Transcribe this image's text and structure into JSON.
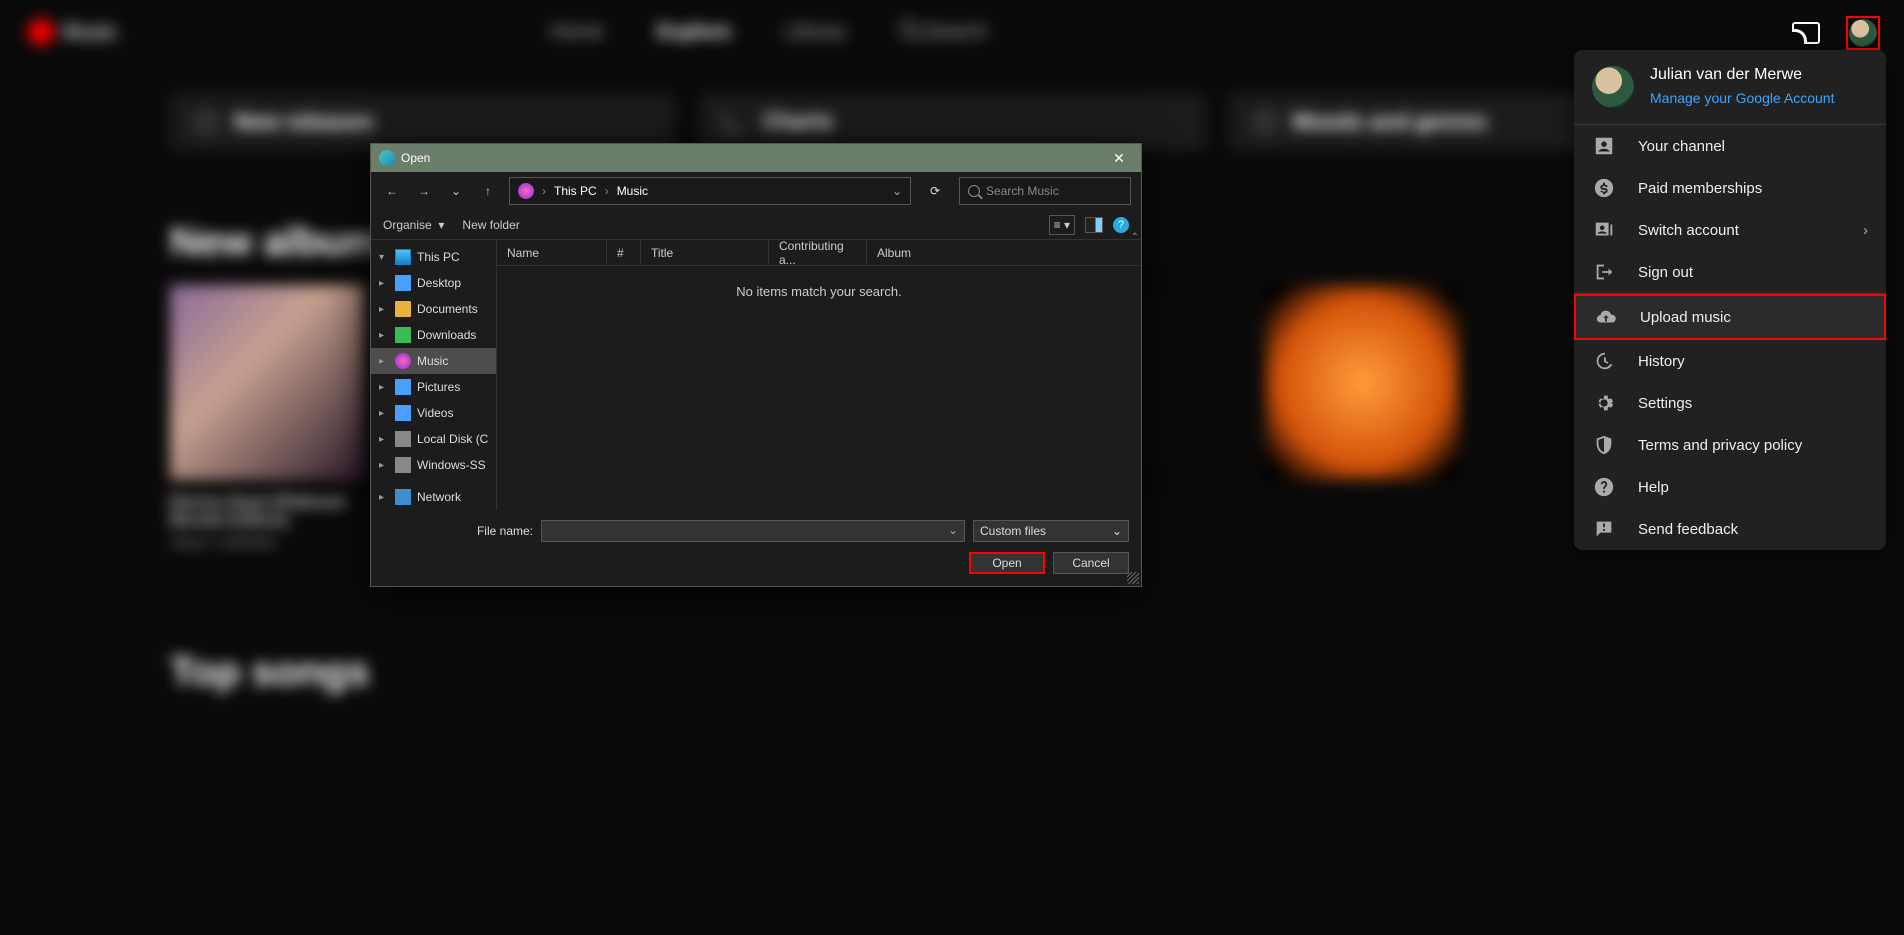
{
  "topbar": {
    "logo": "Music",
    "nav": {
      "home": "Home",
      "explore": "Explore",
      "library": "Library",
      "search": "Search"
    }
  },
  "chips": {
    "new_releases": "New releases",
    "charts": "Charts",
    "moods": "Moods and genres"
  },
  "section1": "New albums and singles",
  "album": {
    "title": "Electra Heart (Platinum Blonde Edition)",
    "sub": "Album • MARINA"
  },
  "section2": "Top songs",
  "profile": {
    "name": "Julian van der Merwe",
    "manage": "Manage your Google Account",
    "items": {
      "channel": "Your channel",
      "paid": "Paid memberships",
      "switch": "Switch account",
      "signout": "Sign out",
      "upload": "Upload music",
      "history": "History",
      "settings": "Settings",
      "terms": "Terms and privacy policy",
      "help": "Help",
      "feedback": "Send feedback"
    }
  },
  "dialog": {
    "title": "Open",
    "crumb1": "This PC",
    "crumb2": "Music",
    "search_placeholder": "Search Music",
    "organise": "Organise",
    "new_folder": "New folder",
    "cols": {
      "name": "Name",
      "num": "#",
      "title": "Title",
      "contrib": "Contributing a...",
      "album": "Album"
    },
    "no_items": "No items match your search.",
    "tree": {
      "this_pc": "This PC",
      "desktop": "Desktop",
      "documents": "Documents",
      "downloads": "Downloads",
      "music": "Music",
      "pictures": "Pictures",
      "videos": "Videos",
      "local": "Local Disk (C",
      "wssd": "Windows-SS",
      "network": "Network"
    },
    "filename_label": "File name:",
    "filetype": "Custom files",
    "open": "Open",
    "cancel": "Cancel"
  }
}
